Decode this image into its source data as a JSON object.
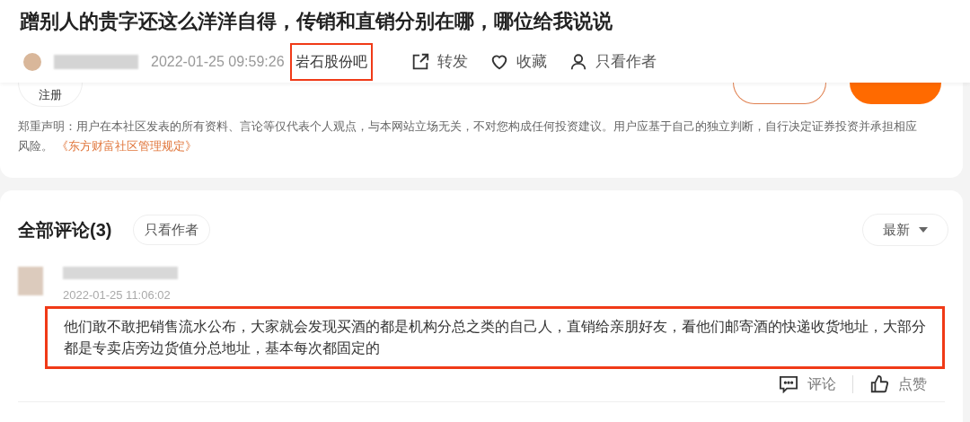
{
  "post": {
    "title": "蹭别人的贵字还这么洋洋自得，传销和直销分别在哪，哪位给我说说",
    "time": "2022-01-25 09:59:26",
    "forum": {
      "label": "岩石股份吧",
      "highlighted": true
    },
    "actions": [
      {
        "kind": "share",
        "label": "转发"
      },
      {
        "kind": "favorite",
        "label": "收藏"
      },
      {
        "kind": "author",
        "label": "只看作者"
      }
    ]
  },
  "editor": {
    "register": "注册"
  },
  "disclaimer": {
    "text": "郑重声明：用户在本社区发表的所有资料、言论等仅代表个人观点，与本网站立场无关，不对您构成任何投资建议。用户应基于自己的独立判断，自行决定证券投资并承担相应风险。",
    "link": "《东方财富社区管理规定》"
  },
  "comments_section": {
    "heading": "全部评论(3)",
    "author_only": "只看作者",
    "sort": "最新",
    "comments": [
      {
        "time": "2022-01-25 11:06:02",
        "text": "他们敢不敢把销售流水公布，大家就会发现买酒的都是机构分总之类的自己人，直销给亲朋好友，看他们邮寄酒的快递收货地址，大部分都是专卖店旁边货值分总地址，基本每次都固定的",
        "highlighted": true,
        "reply": "评论",
        "like": "点赞"
      }
    ]
  }
}
